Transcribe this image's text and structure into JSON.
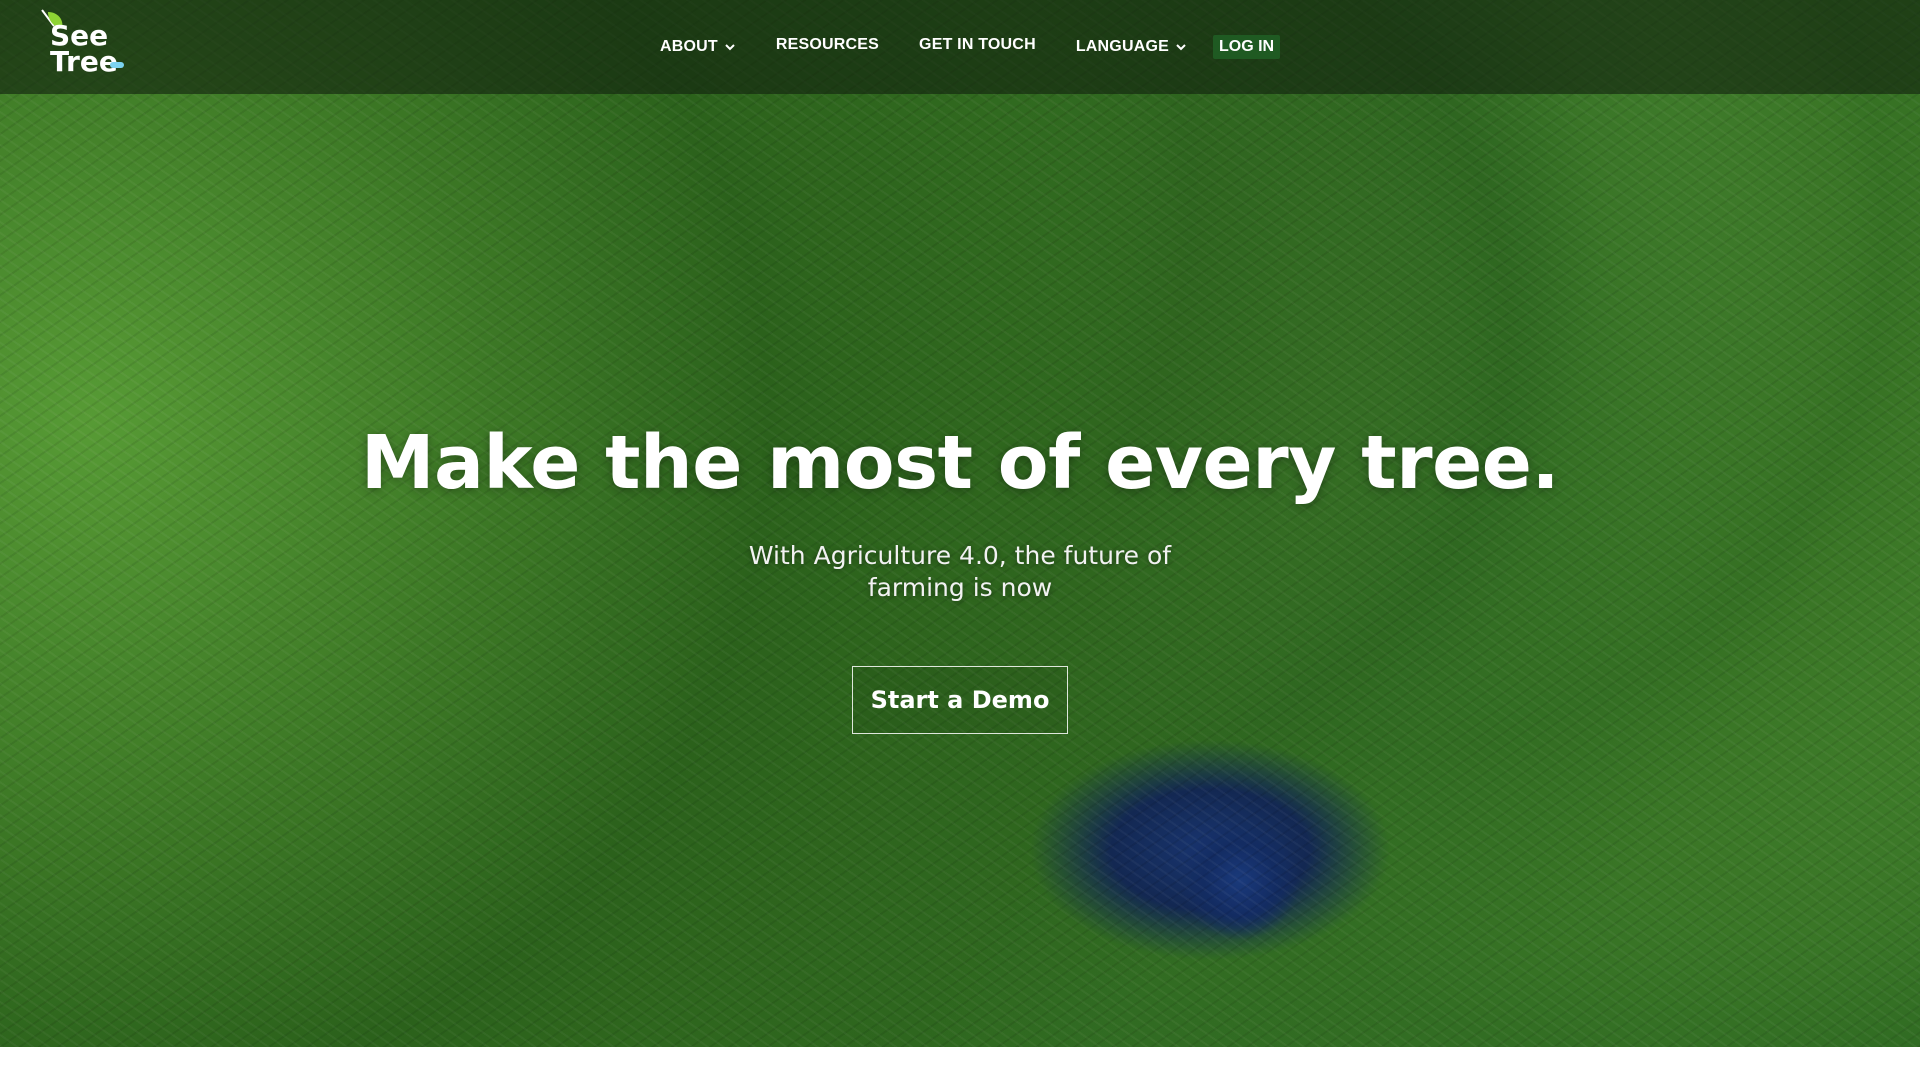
{
  "brand": {
    "logo_line1": "See",
    "logo_line2": "Tree",
    "accent_color": "#8ed334",
    "logo_icon": "leaf-icon"
  },
  "nav": {
    "items": [
      {
        "label": "ABOUT",
        "has_dropdown": true
      },
      {
        "label": "RESOURCES",
        "has_dropdown": false
      },
      {
        "label": "GET IN TOUCH",
        "has_dropdown": false
      },
      {
        "label": "LANGUAGE",
        "has_dropdown": true
      }
    ],
    "login_label": "LOG IN",
    "login_bg": "#1f5a22"
  },
  "hero": {
    "title": "Make the most of every tree.",
    "subtitle": "With Agriculture 4.0, the future of farming is now",
    "cta_label": "Start a Demo",
    "background": "aerial-palm-plantation-photo"
  }
}
